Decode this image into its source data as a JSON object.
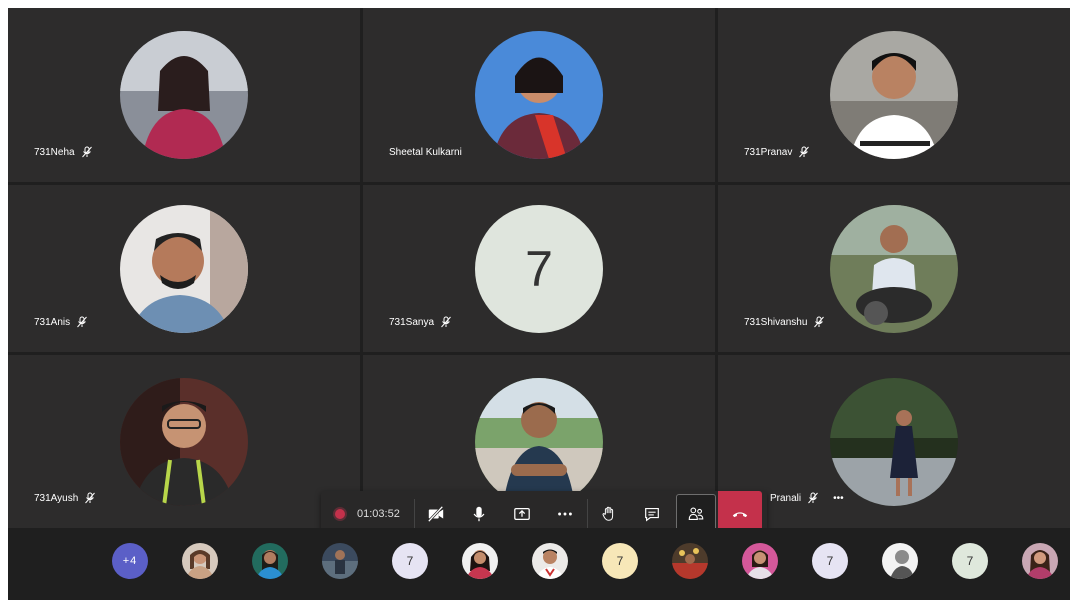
{
  "participants": [
    {
      "name": "731Neha",
      "muted": true,
      "avatar": "photo"
    },
    {
      "name": "Sheetal Kulkarni",
      "muted": false,
      "avatar": "photo"
    },
    {
      "name": "731Pranav",
      "muted": true,
      "avatar": "photo"
    },
    {
      "name": "731Anis",
      "muted": true,
      "avatar": "photo"
    },
    {
      "name": "731Sanya",
      "muted": true,
      "avatar": "initial",
      "initial": "7"
    },
    {
      "name": "731Shivanshu",
      "muted": true,
      "avatar": "photo"
    },
    {
      "name": "731Ayush",
      "muted": true,
      "avatar": "photo"
    },
    {
      "name": "",
      "muted": false,
      "avatar": "photo"
    },
    {
      "name": "Pranali",
      "muted": true,
      "avatar": "photo",
      "more_label": "•••"
    }
  ],
  "toolbar": {
    "timer": "01:03:52",
    "buttons": [
      "camera-off-icon",
      "microphone-icon",
      "share-screen-icon",
      "more-actions-icon",
      "raise-hand-icon",
      "chat-icon",
      "participants-icon",
      "hang-up-icon"
    ]
  },
  "strip": {
    "overflow_label": "+4",
    "items": [
      {
        "type": "photo"
      },
      {
        "type": "photo"
      },
      {
        "type": "photo"
      },
      {
        "type": "initial",
        "label": "7"
      },
      {
        "type": "photo"
      },
      {
        "type": "photo"
      },
      {
        "type": "initial",
        "label": "7"
      },
      {
        "type": "photo"
      },
      {
        "type": "photo"
      },
      {
        "type": "initial",
        "label": "7"
      },
      {
        "type": "photo"
      },
      {
        "type": "initial",
        "label": "7"
      },
      {
        "type": "photo"
      }
    ]
  },
  "colors": {
    "record": "#c4314b",
    "hangup": "#c4314b",
    "overflow": "#5b5fc7",
    "tile": "#2d2c2c"
  }
}
